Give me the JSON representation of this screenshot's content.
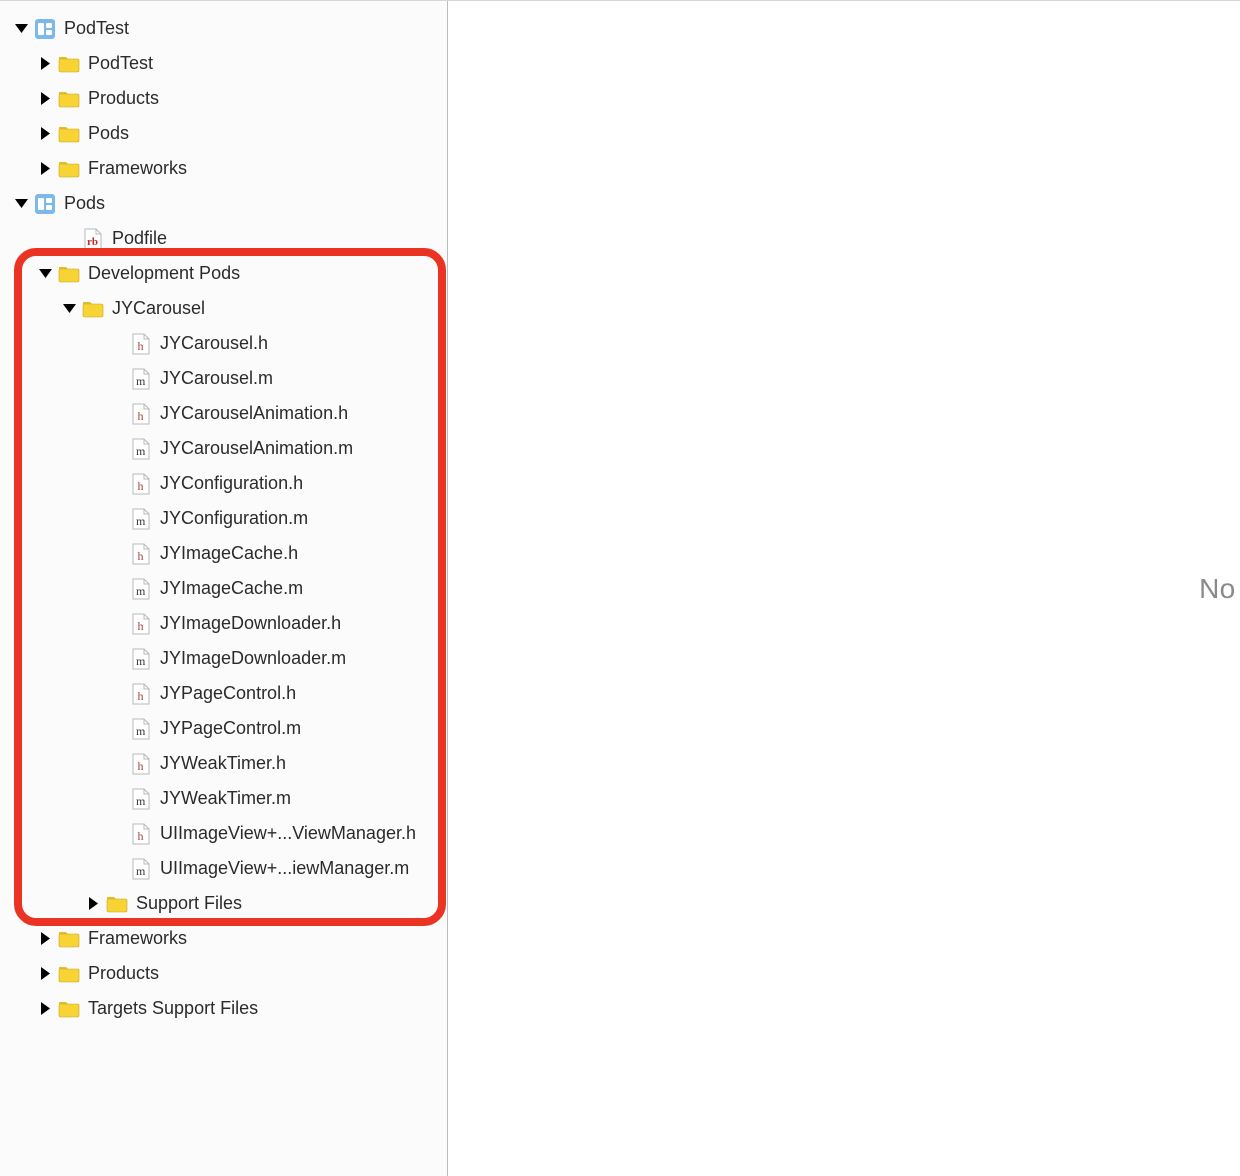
{
  "editor": {
    "placeholder": "No Ed"
  },
  "tree": {
    "podtest_project": "PodTest",
    "podtest_folder": "PodTest",
    "products1": "Products",
    "pods1": "Pods",
    "frameworks1": "Frameworks",
    "pods_project": "Pods",
    "podfile": "Podfile",
    "dev_pods": "Development Pods",
    "jycarousel_folder": "JYCarousel",
    "files": [
      {
        "name": "JYCarousel.h",
        "type": "h"
      },
      {
        "name": "JYCarousel.m",
        "type": "m"
      },
      {
        "name": "JYCarouselAnimation.h",
        "type": "h"
      },
      {
        "name": "JYCarouselAnimation.m",
        "type": "m"
      },
      {
        "name": "JYConfiguration.h",
        "type": "h"
      },
      {
        "name": "JYConfiguration.m",
        "type": "m"
      },
      {
        "name": "JYImageCache.h",
        "type": "h"
      },
      {
        "name": "JYImageCache.m",
        "type": "m"
      },
      {
        "name": "JYImageDownloader.h",
        "type": "h"
      },
      {
        "name": "JYImageDownloader.m",
        "type": "m"
      },
      {
        "name": "JYPageControl.h",
        "type": "h"
      },
      {
        "name": "JYPageControl.m",
        "type": "m"
      },
      {
        "name": "JYWeakTimer.h",
        "type": "h"
      },
      {
        "name": "JYWeakTimer.m",
        "type": "m"
      },
      {
        "name": "UIImageView+...ViewManager.h",
        "type": "h"
      },
      {
        "name": "UIImageView+...iewManager.m",
        "type": "m"
      }
    ],
    "support_files": "Support Files",
    "frameworks2": "Frameworks",
    "products2": "Products",
    "targets_support": "Targets Support Files"
  }
}
